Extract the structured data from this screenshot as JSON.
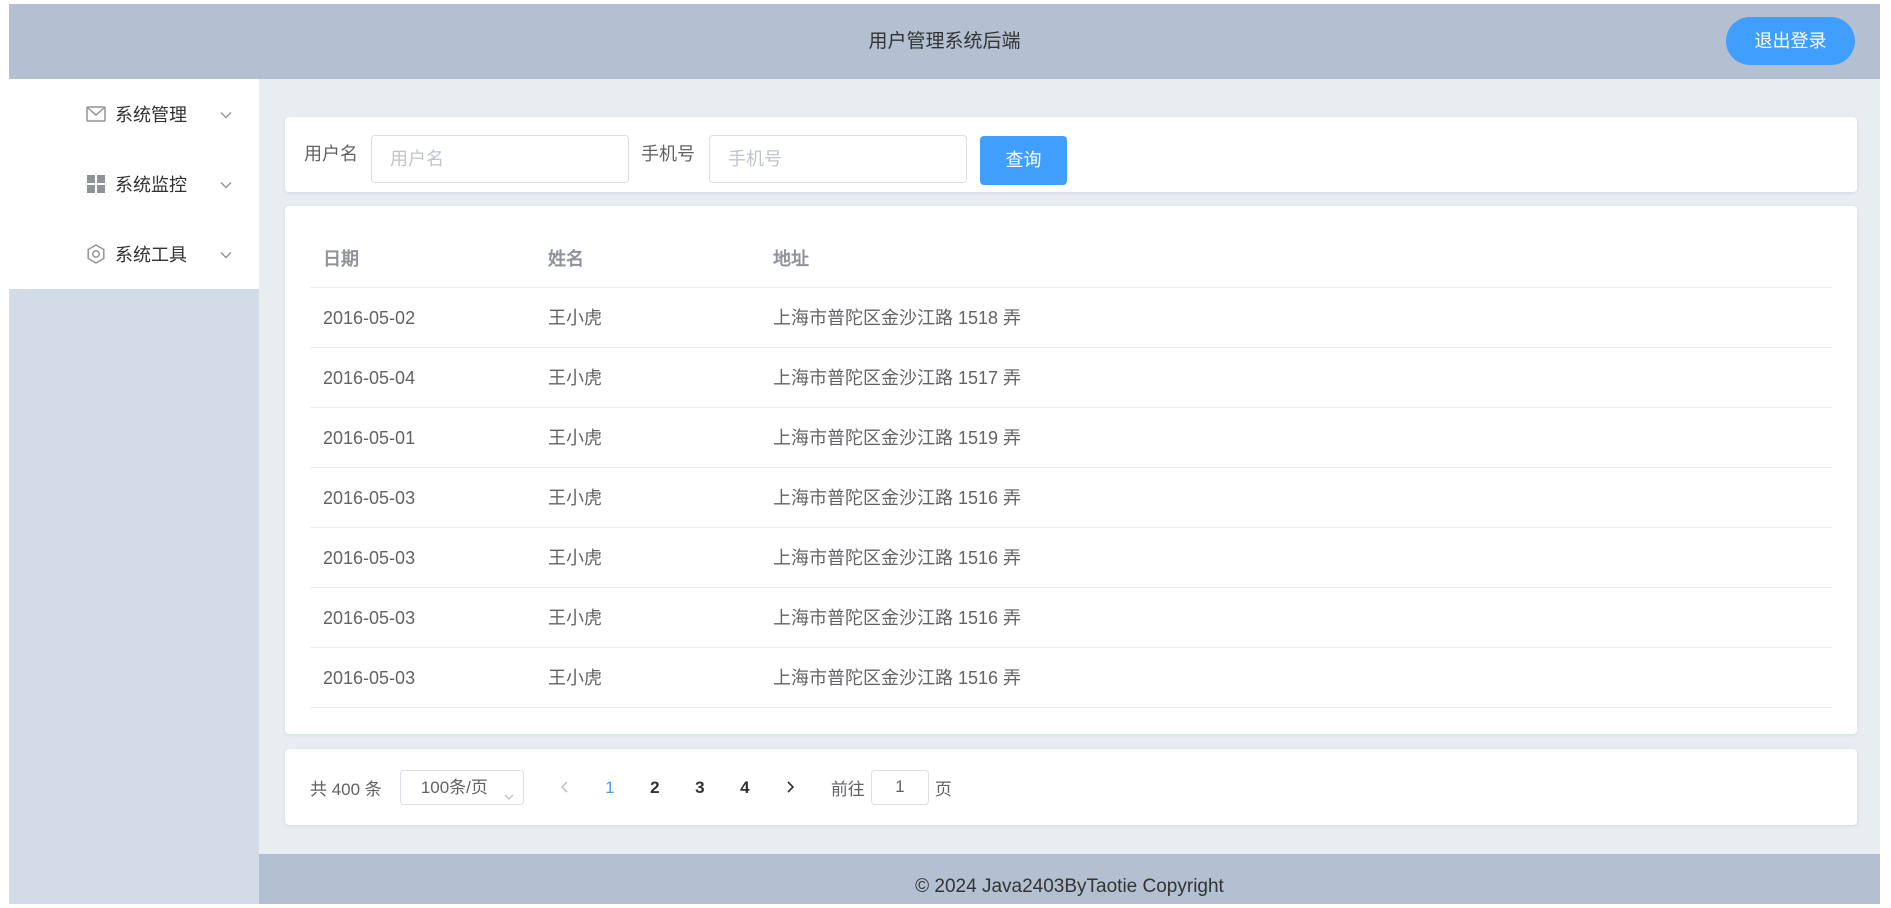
{
  "header": {
    "title": "用户管理系统后端",
    "logout_label": "退出登录"
  },
  "sidebar": {
    "items": [
      {
        "label": "系统管理",
        "icon": "message-icon"
      },
      {
        "label": "系统监控",
        "icon": "grid-icon"
      },
      {
        "label": "系统工具",
        "icon": "setting-icon"
      }
    ]
  },
  "search": {
    "username_label": "用户名",
    "username_placeholder": "用户名",
    "phone_label": "手机号",
    "phone_placeholder": "手机号",
    "query_label": "查询"
  },
  "table": {
    "columns": [
      "日期",
      "姓名",
      "地址"
    ],
    "rows": [
      [
        "2016-05-02",
        "王小虎",
        "上海市普陀区金沙江路 1518 弄"
      ],
      [
        "2016-05-04",
        "王小虎",
        "上海市普陀区金沙江路 1517 弄"
      ],
      [
        "2016-05-01",
        "王小虎",
        "上海市普陀区金沙江路 1519 弄"
      ],
      [
        "2016-05-03",
        "王小虎",
        "上海市普陀区金沙江路 1516 弄"
      ],
      [
        "2016-05-03",
        "王小虎",
        "上海市普陀区金沙江路 1516 弄"
      ],
      [
        "2016-05-03",
        "王小虎",
        "上海市普陀区金沙江路 1516 弄"
      ],
      [
        "2016-05-03",
        "王小虎",
        "上海市普陀区金沙江路 1516 弄"
      ]
    ]
  },
  "pagination": {
    "total_text": "共 400 条",
    "page_size": "100条/页",
    "pages": [
      "1",
      "2",
      "3",
      "4"
    ],
    "current_page": "1",
    "goto_prefix": "前往",
    "goto_value": "1",
    "goto_suffix": "页"
  },
  "footer": {
    "text": "© 2024 Java2403ByTaotie Copyright"
  },
  "colors": {
    "header_bg": "#b3c0d1",
    "sidebar_bg": "#d3dce6",
    "main_bg": "#e8edf2",
    "primary": "#409eff"
  }
}
